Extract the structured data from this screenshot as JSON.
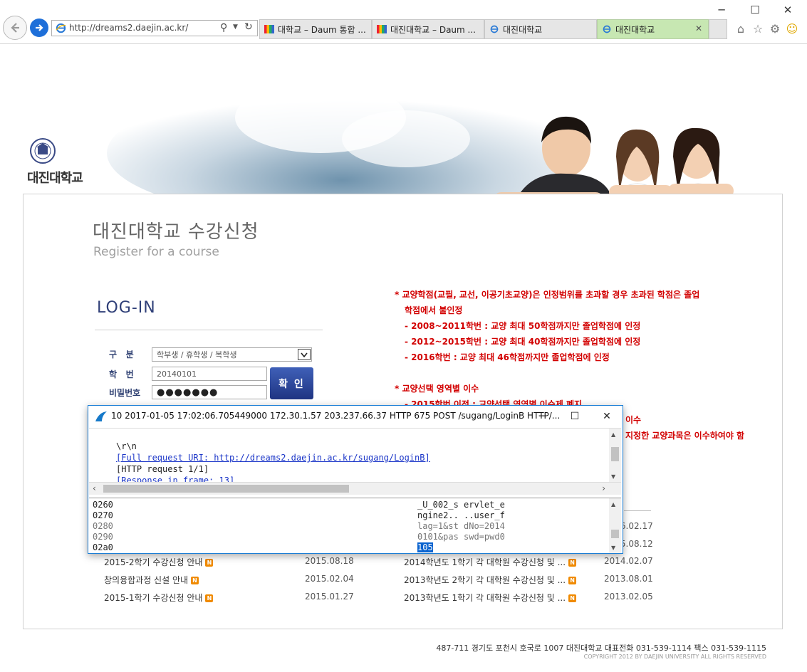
{
  "browser": {
    "address": "http://dreams2.daejin.ac.kr/",
    "tabs": [
      {
        "label": "대학교 – Daum 통합 ...",
        "icon": "daum-icon"
      },
      {
        "label": "대진대학교 – Daum ...",
        "icon": "daum-icon"
      },
      {
        "label": "대진대학교",
        "icon": "ie-icon"
      },
      {
        "label": "대진대학교",
        "icon": "ie-icon",
        "active": true,
        "close": "✕"
      }
    ]
  },
  "logo": {
    "caption": "대진대학교"
  },
  "header": {
    "title": "대진대학교 수강신청",
    "subtitle": "Register for a course"
  },
  "login": {
    "heading": "LOG-IN",
    "type_label": "구   분",
    "type_value": "학부생 / 휴학생 / 복학생",
    "id_label": "학   번",
    "id_value": "20140101",
    "pw_label": "비밀번호",
    "pw_value": "●●●●●●●",
    "submit": "확 인"
  },
  "notices": [
    {
      "star": "*",
      "text": "교양학점(교필, 교선, 이공기초교양)은 인정범위를 초과할 경우 초과된 학점은 졸업"
    },
    {
      "text": "학점에서 불인정"
    },
    {
      "text": "- 2008~2011학번 : 교양 최대 50학점까지만 졸업학점에 인정"
    },
    {
      "text": "- 2012~2015학번 : 교양 최대 40학점까지만 졸업학점에 인정"
    },
    {
      "text": "- 2016학번 : 교양 최대 46학점까지만 졸업학점에 인정"
    },
    {
      "star": "*",
      "text": "교양선택 영역별 이수"
    },
    {
      "text": "- 2015학번 이전 : 교양선택 영역별 이수제 폐지"
    },
    {
      "text": "이수"
    },
    {
      "text": "지정한 교양과목은 이수하여야 함"
    }
  ],
  "list_left": [
    {
      "title": "2015-2학기 수강신청 안내",
      "date": "2015.08.18"
    },
    {
      "title": "창의융합과정 신설 안내",
      "date": "2015.02.04"
    },
    {
      "title": "2015-1학기 수강신청 안내",
      "date": "2015.01.27"
    }
  ],
  "list_right": [
    {
      "title": "",
      "date": "2016.02.17"
    },
    {
      "title": "",
      "date": "2015.08.12"
    },
    {
      "title": "2014학년도 1학기 각 대학원 수강신청 및 ...",
      "date": "2014.02.07"
    },
    {
      "title": "2013학년도 2학기 각 대학원 수강신청 및 ...",
      "date": "2013.08.01"
    },
    {
      "title": "2013학년도 1학기 각 대학원 수강신청 및 ...",
      "date": "2013.02.05"
    }
  ],
  "footer": {
    "address": "487-711 경기도 포천시 호국로 1007 대진대학교 대표전화 031-539-1114   팩스 031-539-1115",
    "copyright": "COPYRIGHT 2012 BY DAEJIN UNIVERSITY ALL RIGHTS RESERVED"
  },
  "wireshark": {
    "title": "10 2017-01-05 17:02:06.705449000 172.30.1.57 203.237.66.37 HTTP 675 POST /sugang/LoginB HTTP/...",
    "detail": {
      "crlf": "\\r\\n",
      "full_uri": "[Full request URI: http://dreams2.daejin.ac.kr/sugang/LoginB]",
      "http_request": "[HTTP request 1/1]",
      "response": "[Response in frame: 13]"
    },
    "hex_rows": [
      {
        "offset": "0260",
        "ascii": "_U_002_s ervlet_e"
      },
      {
        "offset": "0270",
        "ascii": "ngine2.. ..user_f"
      },
      {
        "offset": "0280",
        "ascii": "lag=1&st dNo=2014"
      },
      {
        "offset": "0290",
        "ascii": "0101&pas swd=pwd0"
      },
      {
        "offset": "02a0",
        "ascii": "105"
      }
    ]
  },
  "colors": {
    "notice_red": "#d20000",
    "login_blue": "#2b3d70",
    "selection_blue": "#0a63cf"
  }
}
